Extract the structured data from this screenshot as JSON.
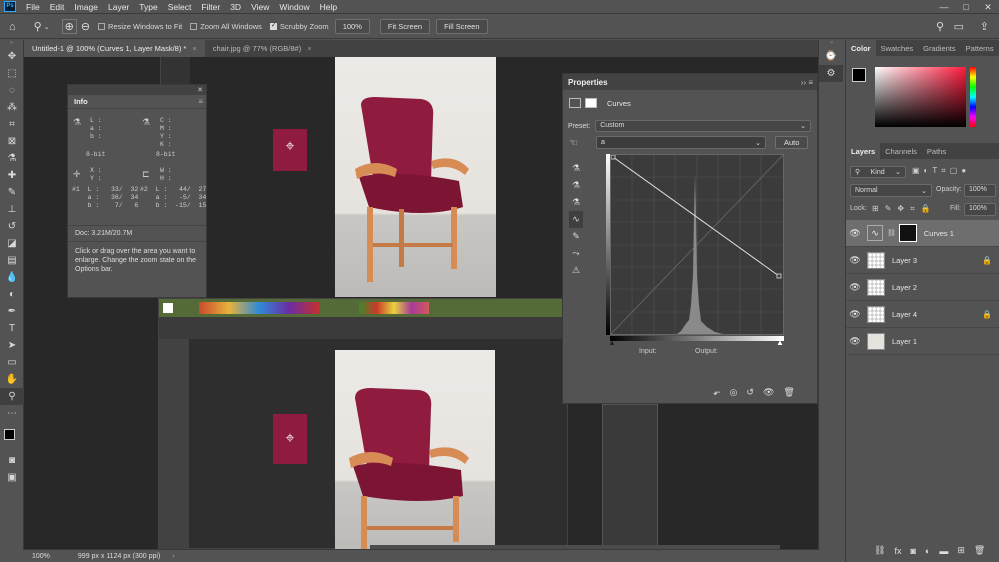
{
  "app": {
    "logo": "Ps"
  },
  "menu": [
    "File",
    "Edit",
    "Image",
    "Layer",
    "Type",
    "Select",
    "Filter",
    "3D",
    "View",
    "Window",
    "Help"
  ],
  "window_controls": {
    "minimize": "—",
    "maximize": "□",
    "close": "✕"
  },
  "options": {
    "resize_windows": "Resize Windows to Fit",
    "zoom_all": "Zoom All Windows",
    "scrubby_zoom": "Scrubby Zoom",
    "zoom_value": "100%",
    "fit_screen": "Fit Screen",
    "fill_screen": "Fill Screen"
  },
  "tabs": [
    {
      "label": "Untitled-1 @ 100% (Curves 1, Layer Mask/8) *",
      "close": "×"
    },
    {
      "label": "chair.jpg @ 77% (RGB/8#)",
      "close": "×"
    }
  ],
  "info": {
    "tab": "Info",
    "col_lab_top": "L :\na :\nb :",
    "col_cmyk_top": "C :\nM :\nY :\nK :",
    "bit_left": "8-bit",
    "bit_right": "8-bit",
    "xy": "X :\nY :",
    "wh": "W :\nH :",
    "sample1": "#1  L :   33/  32\n    a :   36/  34\n    b :    7/   6",
    "sample2": "#2  L :   44/  27\n    a :   -5/  34\n    b :  -15/  15",
    "doc": "Doc: 3.21M/20.7M",
    "help": "Click or drag over the area you want to enlarge. Change the zoom state on the Options bar."
  },
  "properties": {
    "title": "Properties",
    "adjustment": "Curves",
    "preset_label": "Preset:",
    "preset_value": "Custom",
    "channel": "a",
    "auto": "Auto",
    "input_label": "Input:",
    "output_label": "Output:"
  },
  "color_panel": {
    "tabs": [
      "Color",
      "Swatches",
      "Gradients",
      "Patterns"
    ]
  },
  "layers_panel": {
    "tabs": [
      "Layers",
      "Channels",
      "Paths"
    ],
    "kind": "Kind",
    "blend_mode": "Normal",
    "opacity_label": "Opacity:",
    "opacity_value": "100%",
    "lock_label": "Lock:",
    "fill_label": "Fill:",
    "fill_value": "100%",
    "layers": [
      {
        "name": "Curves 1",
        "locked": false,
        "selected": true
      },
      {
        "name": "Layer 3",
        "locked": true,
        "selected": false
      },
      {
        "name": "Layer 2",
        "locked": false,
        "selected": false
      },
      {
        "name": "Layer 4",
        "locked": true,
        "selected": false
      },
      {
        "name": "Layer 1",
        "locked": false,
        "selected": false
      }
    ]
  },
  "status": {
    "zoom": "100%",
    "doc_size": "999 px x 1124 px (300 ppi)"
  },
  "colors": {
    "accent_red": "#8f1b3e",
    "chair_wood": "#d88c55",
    "selection": "#6e6e6e"
  }
}
